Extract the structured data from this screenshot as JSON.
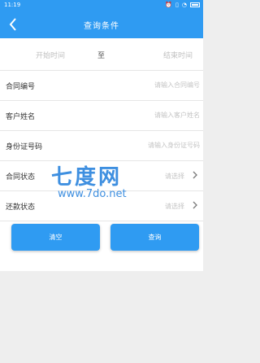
{
  "status_bar": {
    "time": "11:19",
    "icons": [
      "alarm-icon",
      "vibrate-icon",
      "wifi-icon",
      "battery-icon"
    ]
  },
  "header": {
    "title": "查询条件",
    "back_icon": "chevron-left-icon",
    "background": "#2f9bf2"
  },
  "date_range": {
    "start_placeholder": "开始时间",
    "separator": "至",
    "end_placeholder": "结束时间"
  },
  "fields": {
    "contract_no": {
      "label": "合同编号",
      "placeholder": "请输入合同编号",
      "value": ""
    },
    "customer_name": {
      "label": "客户姓名",
      "placeholder": "请输入客户姓名",
      "value": ""
    },
    "id_number": {
      "label": "身份证号码",
      "placeholder": "请输入身份证号码",
      "value": ""
    },
    "contract_status": {
      "label": "合同状态",
      "value": "请选择"
    },
    "repay_status": {
      "label": "还款状态",
      "value": "请选择"
    }
  },
  "actions": {
    "clear_label": "清空",
    "search_label": "查询",
    "button_color": "#2f9bf2"
  },
  "watermark": {
    "logo": "七度网",
    "url": "www.7do.net"
  }
}
